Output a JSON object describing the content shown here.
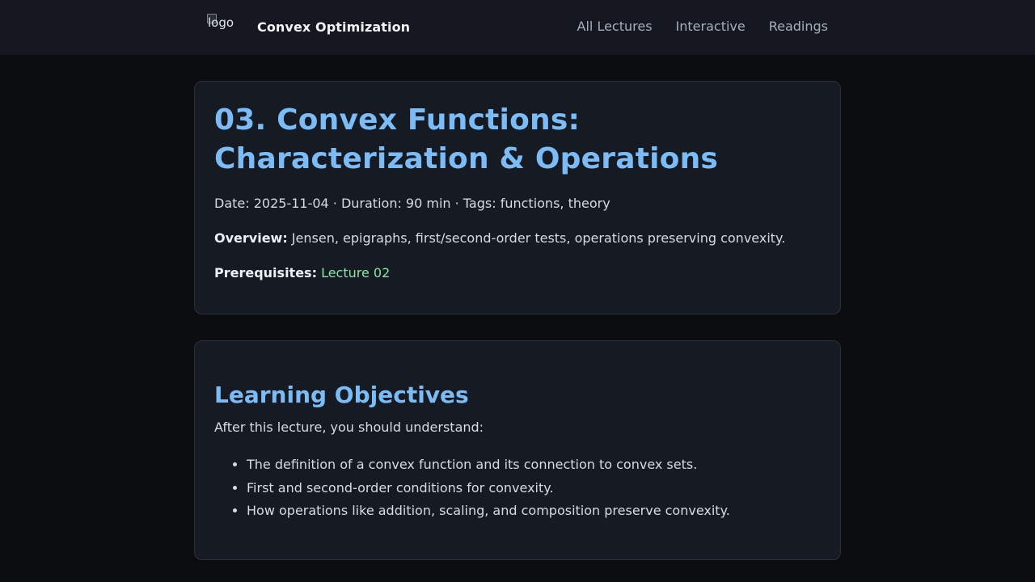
{
  "header": {
    "logo_alt": "logo",
    "site_title": "Convex Optimization",
    "nav": [
      {
        "label": "All Lectures"
      },
      {
        "label": "Interactive"
      },
      {
        "label": "Readings"
      }
    ]
  },
  "lecture": {
    "title": "03. Convex Functions: Characterization & Operations",
    "meta": "Date: 2025-11-04 · Duration: 90 min · Tags: functions, theory",
    "overview_label": "Overview:",
    "overview_text": " Jensen, epigraphs, first/second-order tests, operations preserving convexity.",
    "prereq_label": "Prerequisites:",
    "prereq_link": "Lecture 02"
  },
  "objectives": {
    "heading": "Learning Objectives",
    "intro": "After this lecture, you should understand:",
    "items": [
      "The definition of a convex function and its connection to convex sets.",
      "First and second-order conditions for convexity.",
      "How operations like addition, scaling, and composition preserve convexity."
    ]
  },
  "colors": {
    "background": "#0b0d11",
    "header_bg": "#151821",
    "card_bg": "#161a23",
    "accent_blue": "#7cbcf6",
    "link_green": "#86e7a4"
  }
}
